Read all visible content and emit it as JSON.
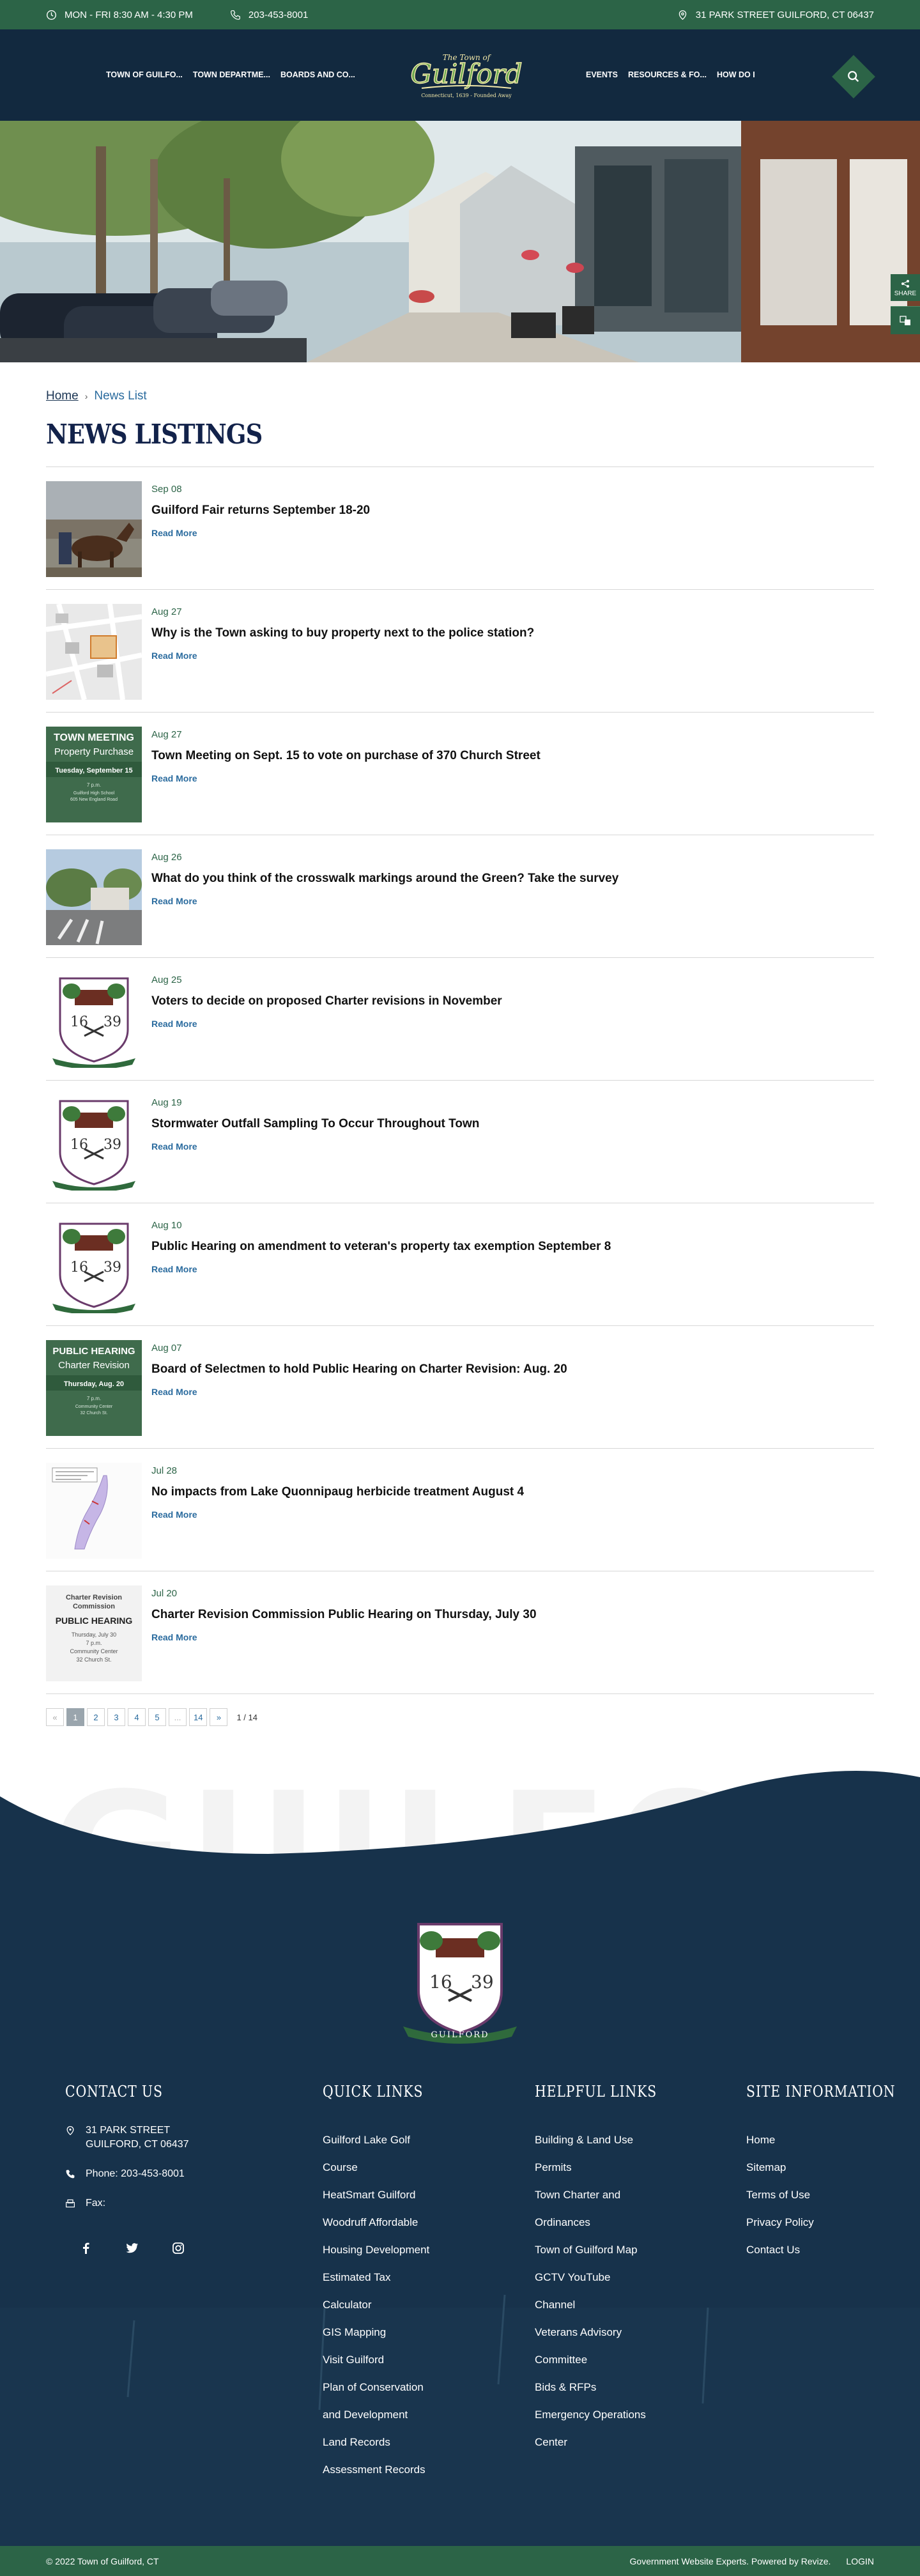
{
  "topbar": {
    "hours": "MON - FRI 8:30 AM - 4:30 PM",
    "phone": "203-453-8001",
    "address": "31 PARK STREET GUILFORD, CT 06437"
  },
  "nav": {
    "left": [
      "TOWN OF GUILFO...",
      "TOWN DEPARTME...",
      "BOARDS AND CO..."
    ],
    "right": [
      "EVENTS",
      "RESOURCES & FO...",
      "HOW DO I"
    ]
  },
  "logo": {
    "top_text": "The Town of",
    "name": "Guilford",
    "tagline": "Connecticut, 1639 - Founded Away"
  },
  "share": {
    "label": "SHARE"
  },
  "breadcrumb": {
    "home": "Home",
    "current": "News List"
  },
  "page_title": "NEWS LISTINGS",
  "news": [
    {
      "date": "Sep 08",
      "title": "Guilford Fair returns September 18-20",
      "read_more": "Read More",
      "thumb": "fair-horses"
    },
    {
      "date": "Aug 27",
      "title": "Why is the Town asking to buy property next to the police station?",
      "read_more": "Read More",
      "thumb": "map"
    },
    {
      "date": "Aug 27",
      "title": "Town Meeting on Sept. 15 to vote on purchase of 370 Church Street",
      "read_more": "Read More",
      "thumb": "town-meeting",
      "thumb_text": [
        "TOWN MEETING",
        "Property Purchase",
        "Tuesday, September 15",
        "7 p.m.",
        "Guilford High School",
        "605 New England Road"
      ]
    },
    {
      "date": "Aug 26",
      "title": "What do you think of the crosswalk markings around the Green? Take the survey",
      "read_more": "Read More",
      "thumb": "crosswalk"
    },
    {
      "date": "Aug 25",
      "title": "Voters to decide on proposed Charter revisions in November",
      "read_more": "Read More",
      "thumb": "seal"
    },
    {
      "date": "Aug 19",
      "title": "Stormwater Outfall Sampling To Occur Throughout Town",
      "read_more": "Read More",
      "thumb": "seal"
    },
    {
      "date": "Aug 10",
      "title": "Public Hearing on amendment to veteran's property tax exemption September 8",
      "read_more": "Read More",
      "thumb": "seal"
    },
    {
      "date": "Aug 07",
      "title": "Board of Selectmen to hold Public Hearing on Charter Revision: Aug. 20",
      "read_more": "Read More",
      "thumb": "public-hearing",
      "thumb_text": [
        "PUBLIC HEARING",
        "Charter Revision",
        "Thursday, Aug. 20",
        "7 p.m.",
        "Community Center",
        "32 Church St."
      ]
    },
    {
      "date": "Jul 28",
      "title": "No impacts from Lake Quonnipaug herbicide treatment August 4",
      "read_more": "Read More",
      "thumb": "lake-map"
    },
    {
      "date": "Jul 20",
      "title": "Charter Revision Commission Public Hearing on Thursday, July 30",
      "read_more": "Read More",
      "thumb": "charter-hearing",
      "thumb_text": [
        "Charter Revision",
        "Commission",
        "PUBLIC HEARING",
        "Thursday, July 30",
        "7 p.m.",
        "Community Center",
        "32 Church St."
      ]
    }
  ],
  "pagination": {
    "prev": "«",
    "pages": [
      "1",
      "2",
      "3",
      "4",
      "5",
      "...",
      "14"
    ],
    "next": "»",
    "current": "1",
    "count": "1 / 14"
  },
  "footer": {
    "watermark": "GUILFORD",
    "seal_year_left": "16",
    "seal_year_right": "39",
    "seal_banner": "GUILFORD",
    "contact": {
      "heading": "CONTACT US",
      "address_line1": "31 PARK STREET",
      "address_line2": "GUILFORD, CT 06437",
      "phone": "Phone: 203-453-8001",
      "fax": "Fax:"
    },
    "quick_links": {
      "heading": "QUICK LINKS",
      "items": [
        "Guilford Lake Golf",
        "Course",
        "HeatSmart Guilford",
        "Woodruff Affordable",
        "Housing Development",
        "Estimated Tax",
        "Calculator",
        "GIS Mapping",
        "Visit Guilford",
        "Plan of Conservation",
        "and Development",
        "Land Records",
        "Assessment Records"
      ]
    },
    "helpful_links": {
      "heading": "HELPFUL LINKS",
      "items": [
        "Building & Land Use",
        "Permits",
        "Town Charter and",
        "Ordinances",
        "Town of Guilford Map",
        "GCTV YouTube",
        "Channel",
        "Veterans Advisory",
        "Committee",
        "Bids & RFPs",
        "Emergency Operations",
        "Center"
      ]
    },
    "site_info": {
      "heading": "SITE INFORMATION",
      "items": [
        "Home",
        "Sitemap",
        "Terms of Use",
        "Privacy Policy",
        "Contact Us"
      ]
    },
    "copyright": "© 2022 Town of Guilford, CT",
    "powered": "Government Website Experts. Powered by Revize.",
    "login": "LOGIN"
  },
  "colors": {
    "green": "#2c6447",
    "navy": "#12293f",
    "link": "#2a6b9e",
    "title": "#12224a"
  }
}
